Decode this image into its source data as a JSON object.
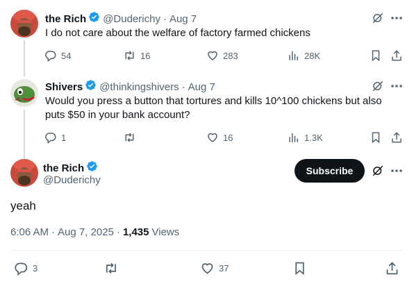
{
  "tweet1": {
    "display_name": "the Rich",
    "handle": "@Duderichy",
    "separator": "·",
    "date": "Aug 7",
    "text": "I do not care about the welfare of factory farmed chickens",
    "replies": "54",
    "retweets": "16",
    "likes": "283",
    "views": "28K"
  },
  "tweet2": {
    "display_name": "Shivers",
    "handle": "@thinkingshivers",
    "separator": "·",
    "date": "Aug 7",
    "text_line1": "Would you press a button that tortures and kills 10^100 chickens but also",
    "text_line2": "puts $50 in your bank account?",
    "replies": "1",
    "retweets": "",
    "likes": "16",
    "views": "1.3K"
  },
  "main_tweet": {
    "display_name": "the Rich",
    "handle": "@Duderichy",
    "subscribe_label": "Subscribe",
    "text": "yeah",
    "time": "6:06 AM",
    "separator": "·",
    "date": "Aug 7, 2025",
    "separator2": "·",
    "views_count": "1,435",
    "views_label": "Views",
    "replies": "3",
    "retweets": "",
    "likes": "37"
  },
  "colors": {
    "text": "#0f1419",
    "secondary": "#536471",
    "verified": "#1d9bf0",
    "subscribe_bg": "#0f1419"
  },
  "icons": {
    "reply": "reply-icon",
    "retweet": "retweet-icon",
    "like": "heart-icon",
    "views": "views-icon",
    "bookmark": "bookmark-icon",
    "share": "share-icon",
    "grok": "grok-icon",
    "more": "more-icon",
    "verified": "verified-badge-icon"
  }
}
